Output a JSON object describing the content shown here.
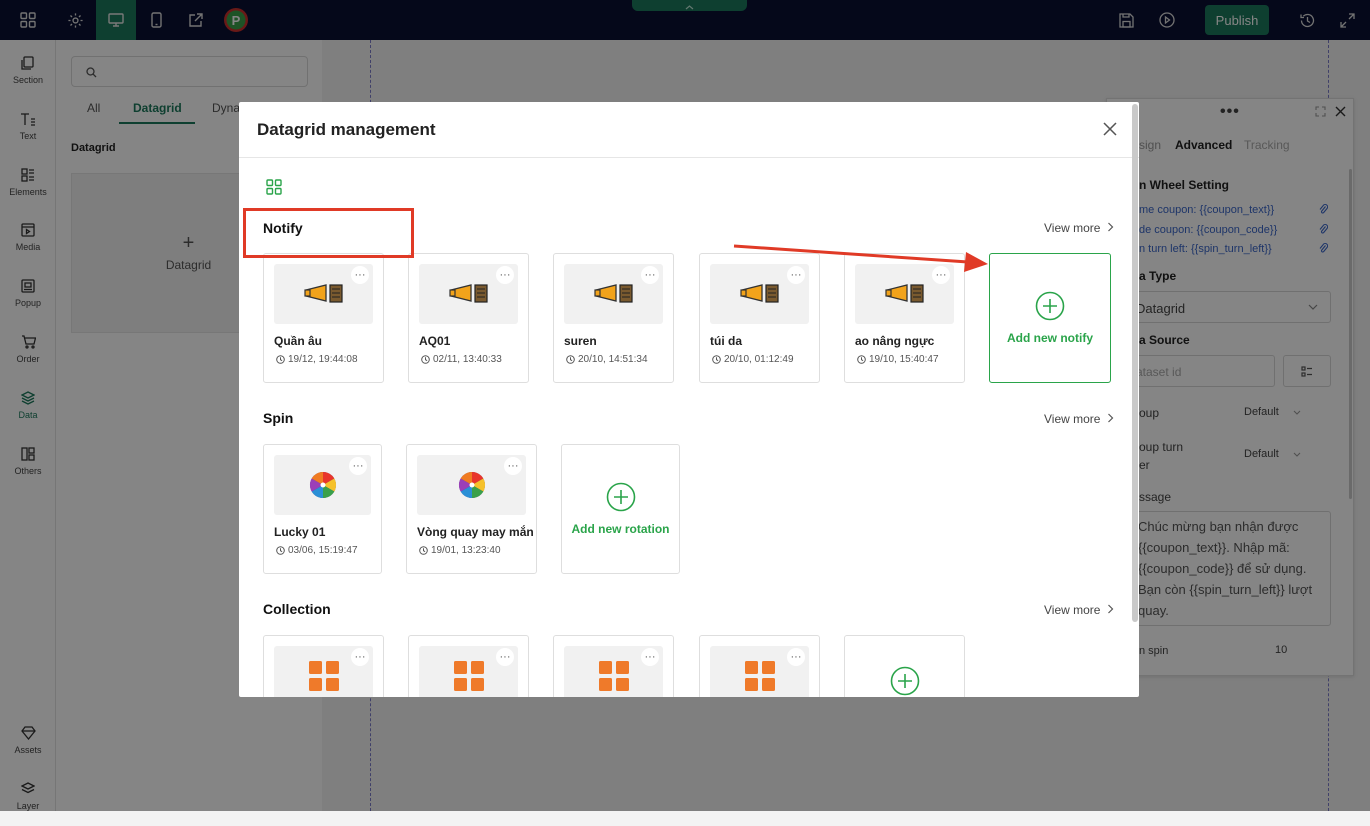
{
  "topbar": {
    "publish_label": "Publish",
    "icons": [
      "grid-icon",
      "settings-icon",
      "desktop-icon",
      "mobile-icon",
      "share-icon",
      "p-logo",
      "save-icon",
      "play-icon",
      "history-icon",
      "fullscreen-icon"
    ]
  },
  "sidebar": {
    "items": [
      {
        "label": "Section",
        "icon": "section-icon"
      },
      {
        "label": "Text",
        "icon": "text-icon"
      },
      {
        "label": "Elements",
        "icon": "elements-icon"
      },
      {
        "label": "Media",
        "icon": "media-icon"
      },
      {
        "label": "Popup",
        "icon": "popup-icon"
      },
      {
        "label": "Order",
        "icon": "cart-icon"
      },
      {
        "label": "Data",
        "icon": "data-icon"
      },
      {
        "label": "Others",
        "icon": "others-icon"
      },
      {
        "label": "Assets",
        "icon": "assets-icon"
      },
      {
        "label": "Layer",
        "icon": "layer-icon"
      }
    ]
  },
  "leftpanel": {
    "tabs": [
      "All",
      "Datagrid",
      "Dyna"
    ],
    "heading": "Datagrid",
    "add_label": "Datagrid"
  },
  "rightpanel": {
    "tabs": [
      "sign",
      "Advanced",
      "Tracking"
    ],
    "section_title": "n Wheel Setting",
    "links": [
      "me coupon: {{coupon_text}}",
      "de coupon: {{coupon_code}}",
      "n turn left: {{spin_turn_left}}"
    ],
    "data_type_label": "a Type",
    "data_type_value": "Datagrid",
    "data_source_label": "a Source",
    "dataset_placeholder": "ataset id",
    "popup_label": "oup",
    "popup_value": "Default",
    "popup_turn_label_1": "oup turn",
    "popup_turn_label_2": "er",
    "popup_turn_value": "Default",
    "message_label": "ssage",
    "message_lines": [
      "Chúc mừng bạn nhận được",
      "{{coupon_text}}. Nhập mã:",
      "{{coupon_code}} để sử dụng.",
      "Bạn còn {{spin_turn_left}} lượt",
      "quay."
    ],
    "spin_label": "n spin",
    "spin_value": "10"
  },
  "modal": {
    "title": "Datagrid management",
    "view_more": "View more",
    "sections": [
      {
        "title": "Notify",
        "add_label": "Add new notify",
        "items": [
          {
            "name": "Quần âu",
            "time": "19/12, 19:44:08"
          },
          {
            "name": "AQ01",
            "time": "02/11, 13:40:33"
          },
          {
            "name": "suren",
            "time": "20/10, 14:51:34"
          },
          {
            "name": "túi da",
            "time": "20/10, 01:12:49"
          },
          {
            "name": "ao nâng ngực",
            "time": "19/10, 15:40:47"
          }
        ]
      },
      {
        "title": "Spin",
        "add_label": "Add new rotation",
        "items": [
          {
            "name": "Lucky 01",
            "time": "03/06, 15:19:47"
          },
          {
            "name": "Vòng quay may mắn",
            "time": "19/01, 13:23:40"
          }
        ]
      },
      {
        "title": "Collection",
        "add_label": "",
        "items": [
          {},
          {},
          {},
          {}
        ]
      }
    ]
  },
  "colors": {
    "topbar": "#0b1033",
    "accent": "#1c7a5c",
    "add_green": "#2aa44a",
    "annotation_red": "#e03a26"
  }
}
